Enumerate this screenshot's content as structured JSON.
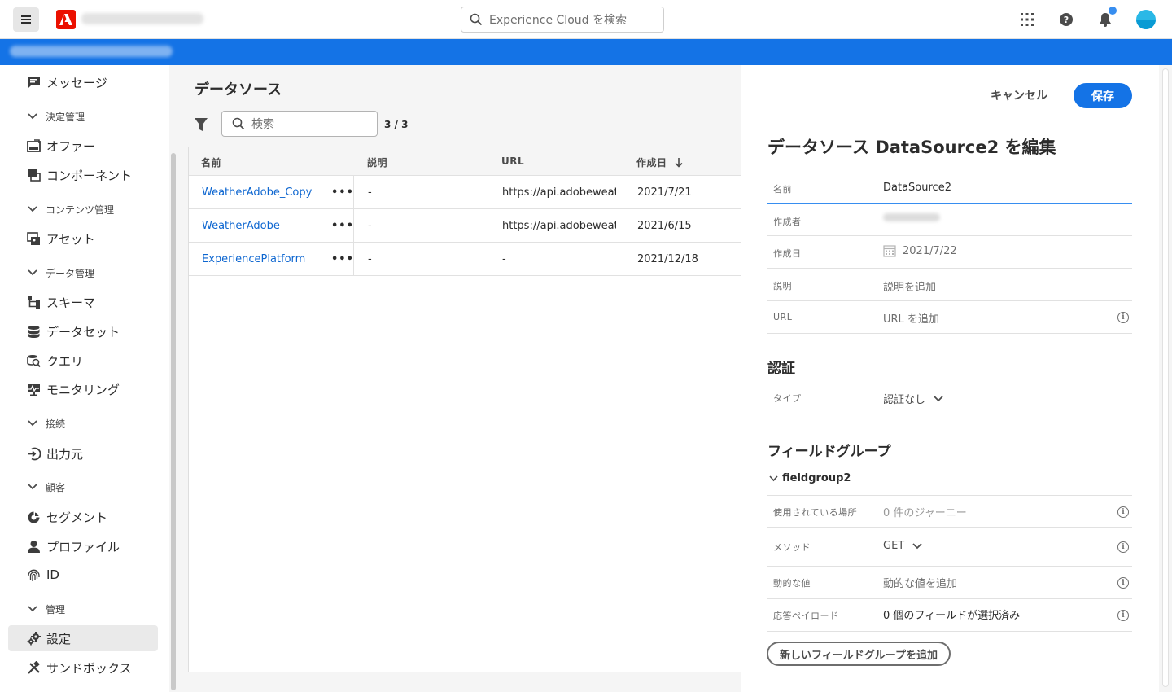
{
  "header": {
    "search_placeholder": "Experience Cloud を検索"
  },
  "sidebar": {
    "items": [
      {
        "label": "メッセージ"
      },
      {
        "label": "決定管理"
      },
      {
        "label": "オファー"
      },
      {
        "label": "コンポーネント"
      },
      {
        "label": "コンテンツ管理"
      },
      {
        "label": "アセット"
      },
      {
        "label": "データ管理"
      },
      {
        "label": "スキーマ"
      },
      {
        "label": "データセット"
      },
      {
        "label": "クエリ"
      },
      {
        "label": "モニタリング"
      },
      {
        "label": "接続"
      },
      {
        "label": "出力元"
      },
      {
        "label": "顧客"
      },
      {
        "label": "セグメント"
      },
      {
        "label": "プロファイル"
      },
      {
        "label": "ID"
      },
      {
        "label": "管理"
      },
      {
        "label": "設定"
      },
      {
        "label": "サンドボックス"
      }
    ]
  },
  "list": {
    "title": "データソース",
    "search_placeholder": "検索",
    "count": "3 / 3",
    "columns": {
      "name": "名前",
      "description": "説明",
      "url": "URL",
      "created": "作成日"
    },
    "rows": [
      {
        "name": "WeatherAdobe_Copy",
        "more": "•••",
        "description": "-",
        "url": "https://api.adobeweathe",
        "created": "2021/7/21"
      },
      {
        "name": "WeatherAdobe",
        "more": "•••",
        "description": "-",
        "url": "https://api.adobeweathe",
        "created": "2021/6/15"
      },
      {
        "name": "ExperiencePlatform",
        "more": "•••",
        "description": "-",
        "url": "-",
        "created": "2021/12/18"
      }
    ]
  },
  "panel": {
    "cancel_label": "キャンセル",
    "save_label": "保存",
    "title": "データソース DataSource2 を編集",
    "fields": {
      "name_label": "名前",
      "name_value": "DataSource2",
      "author_label": "作成者",
      "created_label": "作成日",
      "created_value": "2021/7/22",
      "description_label": "説明",
      "description_placeholder": "説明を追加",
      "url_label": "URL",
      "url_placeholder": "URL を追加"
    },
    "auth": {
      "heading": "認証",
      "type_label": "タイプ",
      "type_value": "認証なし"
    },
    "field_groups": {
      "heading": "フィールドグループ",
      "group_name": "fieldgroup2",
      "used_in_label": "使用されている場所",
      "used_in_value": "0 件のジャーニー",
      "method_label": "メソッド",
      "method_value": "GET",
      "dynamic_label": "動的な値",
      "dynamic_placeholder": "動的な値を追加",
      "payload_label": "応答ペイロード",
      "payload_value": "0 個のフィールドが選択済み",
      "add_button": "新しいフィールドグループを追加"
    },
    "info_glyph": "i"
  },
  "colors": {
    "accent": "#1473e6",
    "link": "#0d66d0",
    "adobe_red": "#eb1000"
  }
}
